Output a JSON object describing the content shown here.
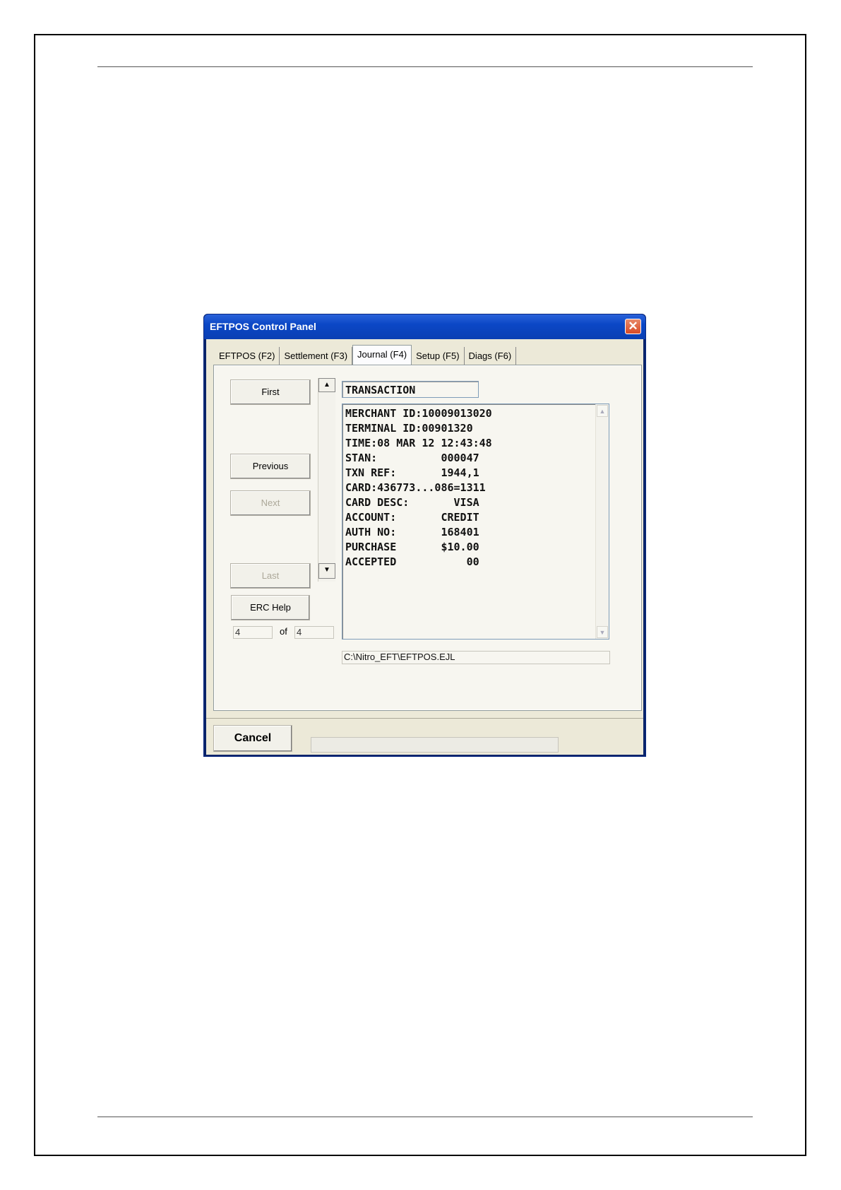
{
  "window": {
    "title": "EFTPOS Control Panel",
    "close_label": "✕"
  },
  "tabs": [
    {
      "label": "EFTPOS (F2)",
      "active": false
    },
    {
      "label": "Settlement (F3)",
      "active": false
    },
    {
      "label": "Journal (F4)",
      "active": true
    },
    {
      "label": "Setup (F5)",
      "active": false
    },
    {
      "label": "Diags (F6)",
      "active": false
    }
  ],
  "nav": {
    "first": "First",
    "previous": "Previous",
    "next": "Next",
    "last": "Last",
    "help": "ERC Help",
    "up_arrow": "▲",
    "down_arrow": "▼",
    "current_record": "4",
    "of_label": "of",
    "total_records": "4"
  },
  "journal": {
    "header": "TRANSACTION",
    "lines": [
      "MERCHANT ID:10009013020",
      "TERMINAL ID:00901320",
      "TIME:08 MAR 12 12:43:48",
      "STAN:          000047",
      "TXN REF:       1944,1",
      "CARD:436773...086=1311",
      "CARD DESC:       VISA",
      "ACCOUNT:       CREDIT",
      "AUTH NO:       168401",
      "PURCHASE       $10.00",
      "ACCEPTED           00"
    ],
    "file_path": "C:\\Nitro_EFT\\EFTPOS.EJL"
  },
  "footer": {
    "cancel_label": "Cancel",
    "status_text": ""
  }
}
